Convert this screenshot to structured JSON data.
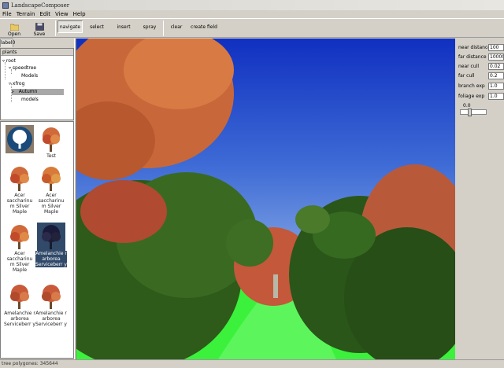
{
  "window": {
    "title": "LandscapeComposer"
  },
  "menu": [
    "File",
    "Terrain",
    "Edit",
    "View",
    "Help"
  ],
  "toolbar": {
    "open_label": "Open",
    "save_label": "Save",
    "modes": [
      "navigate",
      "select",
      "insert",
      "spray"
    ],
    "active_mode": "navigate",
    "clear_label": "clear",
    "create_field_label": "create field"
  },
  "left_tab": "label0",
  "tree": {
    "header": "plants",
    "nodes": [
      "root",
      "speedtree",
      "Models",
      "xfrog",
      "Autumn",
      "models"
    ],
    "selected": "Autumn"
  },
  "thumbnails": [
    {
      "label": ""
    },
    {
      "label": "Test"
    },
    {
      "label": "Acer saccharinu m Silver Maple"
    },
    {
      "label": "Acer saccharinu m Silver Maple"
    },
    {
      "label": "Acer saccharinu m Silver Maple"
    },
    {
      "label": "Amelanchie r arborea Serviceberr y"
    },
    {
      "label": "Amelanchie r arborea Serviceberr y"
    },
    {
      "label": "Amelanchie r arborea Serviceberr y"
    }
  ],
  "parameters": [
    {
      "label": "near distance",
      "value": "100"
    },
    {
      "label": "far distance",
      "value": "10000"
    },
    {
      "label": "near cull",
      "value": "0.02"
    },
    {
      "label": "far cull",
      "value": "0.2"
    },
    {
      "label": "branch exp",
      "value": "1.0"
    },
    {
      "label": "foliage exp",
      "value": "1.0"
    }
  ],
  "slider": {
    "value_label": "0.0",
    "position": 0.3
  },
  "status": {
    "text": "tree polygones: 345644"
  },
  "colors": {
    "sky_top": "#1030c0",
    "grass": "#3cf13c",
    "foliage_orange": "#c8683a",
    "foliage_green": "#2e5a1a"
  }
}
